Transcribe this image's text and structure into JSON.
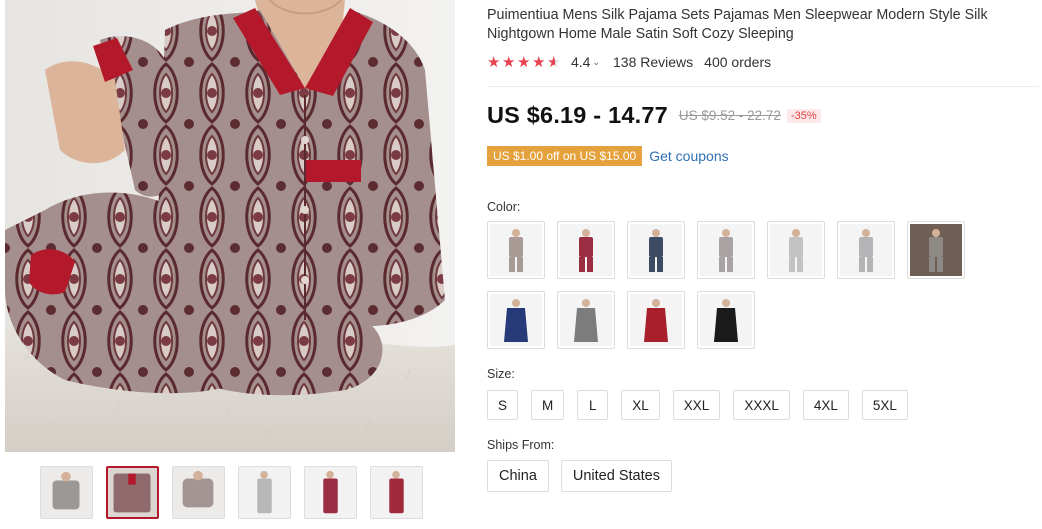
{
  "product": {
    "title": "Puimentiua Mens Silk Pajama Sets Pajamas Men Sleepwear Modern Style Silk Nightgown Home Male Satin Soft Cozy Sleeping",
    "rating_value": "4.4",
    "rating_stars": 4.4,
    "reviews": "138 Reviews",
    "orders": "400 orders"
  },
  "price": {
    "current": "US $6.19 - 14.77",
    "original": "US $9.52 - 22.72",
    "discount": "-35%"
  },
  "coupon": {
    "badge": "US $1.00 off on US $15.00",
    "link": "Get coupons"
  },
  "colors": {
    "label": "Color:",
    "swatches": [
      {
        "name": "silver-paisley-set",
        "color": "#a89a94"
      },
      {
        "name": "burgundy-set",
        "color": "#9b2e42"
      },
      {
        "name": "navy-set",
        "color": "#3d4a66"
      },
      {
        "name": "grey-paisley-set",
        "color": "#a9a4a3"
      },
      {
        "name": "light-grey-set",
        "color": "#c2c2c2"
      },
      {
        "name": "silver-set",
        "color": "#b4b4b6"
      },
      {
        "name": "grey-lifestyle",
        "color": "#8d8a86"
      },
      {
        "name": "navy-robe",
        "color": "#263a78"
      },
      {
        "name": "grey-robe",
        "color": "#7c7c7c"
      },
      {
        "name": "red-robe",
        "color": "#a8202c"
      },
      {
        "name": "black-robe",
        "color": "#1a1a1a"
      }
    ]
  },
  "sizes": {
    "label": "Size:",
    "options": [
      "S",
      "M",
      "L",
      "XL",
      "XXL",
      "XXXL",
      "4XL",
      "5XL"
    ]
  },
  "ships_from": {
    "label": "Ships From:",
    "options": [
      "China",
      "United States"
    ]
  },
  "gallery": {
    "active_index": 1,
    "thumbs": [
      {
        "name": "thumb-grey-seated",
        "color": "#9c9896"
      },
      {
        "name": "thumb-paisley-closeup",
        "color": "#8e6a6c"
      },
      {
        "name": "thumb-paisley-seated",
        "color": "#a39593"
      },
      {
        "name": "thumb-grey-standing",
        "color": "#b7b7b7"
      },
      {
        "name": "thumb-burgundy-standing",
        "color": "#9a2d42"
      },
      {
        "name": "thumb-red-standing",
        "color": "#a12a3a"
      }
    ]
  },
  "theme": {
    "accent": "#e8424f",
    "coupon": "#e5a23c",
    "link": "#2f6fb3"
  }
}
